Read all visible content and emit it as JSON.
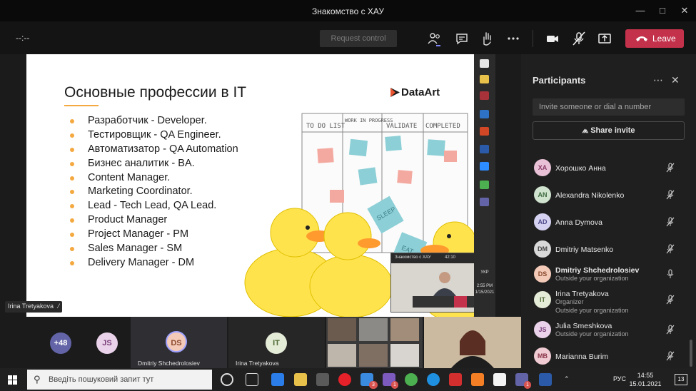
{
  "window": {
    "title": "Знакомство с ХАУ"
  },
  "toolbar": {
    "timer": "--:--",
    "request_control": "Request control",
    "leave": "Leave",
    "colors": {
      "leave": "#c4314b"
    }
  },
  "slide": {
    "title": "Основные профессии в IT",
    "logo": "DataArt",
    "bullets": [
      "Разработчик - Developer.",
      "Тестировщик - QA Engineer.",
      "Автоматизатор - QA Automation",
      "Бизнес аналитик - BA.",
      "Content Manager.",
      "Marketing Coordinator.",
      "Lead - Tech Lead, QA Lead.",
      "Product Manager",
      "Project Manager - PM",
      "Sales Manager - SM",
      "Delivery Manager - DM"
    ],
    "board_columns": [
      "TO DO LIST",
      "WORK IN PROGRESS",
      "VALIDATE",
      "COMPLETED"
    ],
    "stickies": [
      "SLEEP",
      "EAT"
    ]
  },
  "mini_video": {
    "title": "Знакомство с ХАУ",
    "time": "42:10"
  },
  "side_clock": {
    "time": "2:55 PM",
    "date": "1/15/2021",
    "lang": "УКР"
  },
  "presenter": {
    "name": "Irina Tretyakova"
  },
  "panel": {
    "title": "Participants",
    "invite_placeholder": "Invite someone or dial a number",
    "share_invite": "Share invite",
    "people": [
      {
        "initials": "ХА",
        "name": "Хорошко Анна",
        "sub": "",
        "sub2": "",
        "mic": "muted",
        "color": "#e8c1d6",
        "text_color": "#8a3a66"
      },
      {
        "initials": "AN",
        "name": "Alexandra Nikolenko",
        "sub": "",
        "sub2": "",
        "mic": "muted",
        "color": "#cfe3cf",
        "text_color": "#3f6b3f"
      },
      {
        "initials": "AD",
        "name": "Anna Dymova",
        "sub": "",
        "sub2": "",
        "mic": "muted",
        "color": "#d4d2f0",
        "text_color": "#4f4a8a"
      },
      {
        "initials": "DM",
        "name": "Dmitriy Matsenko",
        "sub": "",
        "sub2": "",
        "mic": "muted",
        "color": "#d9d9d9",
        "text_color": "#444444"
      },
      {
        "initials": "DS",
        "name": "Dmitriy Shchedrolosiev",
        "sub": "Outside your organization",
        "sub2": "",
        "mic": "on",
        "color": "#f3c9b8",
        "text_color": "#8a4a2e"
      },
      {
        "initials": "IT",
        "name": "Irina Tretyakova",
        "sub": "Organizer",
        "sub2": "Outside your organization",
        "mic": "muted",
        "color": "#e4ebd7",
        "text_color": "#4f6b35"
      },
      {
        "initials": "JS",
        "name": "Julia Smeshkova",
        "sub": "Outside your organization",
        "sub2": "",
        "mic": "muted",
        "color": "#ead3ea",
        "text_color": "#7a3f7a"
      },
      {
        "initials": "MB",
        "name": "Marianna Burim",
        "sub": "",
        "sub2": "",
        "mic": "muted",
        "color": "#f0cbd3",
        "text_color": "#8a3548"
      }
    ]
  },
  "tiles": {
    "more_count": "+48",
    "js_initials": "JS",
    "ds_initials": "DS",
    "ds_name": "Dmitriy Shchedrolosiev",
    "it_initials": "IT",
    "it_name": "Irina Tretyakova"
  },
  "taskbar": {
    "search_placeholder": "Введіть пошуковий запит тут",
    "lang": "РУС",
    "time": "14:55",
    "date": "15.01.2021",
    "notifications": "13",
    "badge_3": "3",
    "badge_1": "1"
  }
}
